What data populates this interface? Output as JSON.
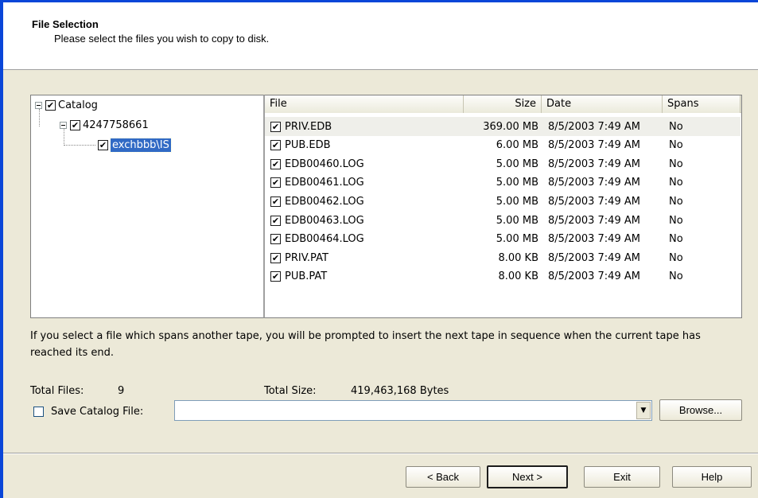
{
  "header": {
    "title": "File Selection",
    "subtitle": "Please select the files you wish to copy to disk."
  },
  "tree": {
    "nodes": [
      {
        "label": "Catalog",
        "checked": true,
        "expanded": true
      },
      {
        "label": "4247758661",
        "checked": true,
        "expanded": true
      },
      {
        "label": "exchbbb\\IS",
        "checked": true,
        "selected": true
      }
    ]
  },
  "file_list": {
    "columns": [
      "File",
      "Size",
      "Date",
      "Spans"
    ],
    "rows": [
      {
        "file": "PRIV.EDB",
        "size": "369.00 MB",
        "date": "8/5/2003 7:49 AM",
        "spans": "No",
        "checked": true
      },
      {
        "file": "PUB.EDB",
        "size": "6.00 MB",
        "date": "8/5/2003 7:49 AM",
        "spans": "No",
        "checked": true
      },
      {
        "file": "EDB00460.LOG",
        "size": "5.00 MB",
        "date": "8/5/2003 7:49 AM",
        "spans": "No",
        "checked": true
      },
      {
        "file": "EDB00461.LOG",
        "size": "5.00 MB",
        "date": "8/5/2003 7:49 AM",
        "spans": "No",
        "checked": true
      },
      {
        "file": "EDB00462.LOG",
        "size": "5.00 MB",
        "date": "8/5/2003 7:49 AM",
        "spans": "No",
        "checked": true
      },
      {
        "file": "EDB00463.LOG",
        "size": "5.00 MB",
        "date": "8/5/2003 7:49 AM",
        "spans": "No",
        "checked": true
      },
      {
        "file": "EDB00464.LOG",
        "size": "5.00 MB",
        "date": "8/5/2003 7:49 AM",
        "spans": "No",
        "checked": true
      },
      {
        "file": "PRIV.PAT",
        "size": "8.00 KB",
        "date": "8/5/2003 7:49 AM",
        "spans": "No",
        "checked": true
      },
      {
        "file": "PUB.PAT",
        "size": "8.00 KB",
        "date": "8/5/2003 7:49 AM",
        "spans": "No",
        "checked": true
      }
    ]
  },
  "info": {
    "text": "If you select a file which spans another tape, you will be prompted to insert the next tape in sequence when the current tape has reached its end."
  },
  "totals": {
    "files_label": "Total Files:",
    "files_value": "9",
    "size_label": "Total Size:",
    "size_value": "419,463,168 Bytes"
  },
  "save_catalog": {
    "label": "Save Catalog File:",
    "checked": false,
    "value": ""
  },
  "buttons": {
    "browse": "Browse...",
    "back": "< Back",
    "next": "Next >",
    "exit": "Exit",
    "help": "Help"
  },
  "colors": {
    "accent": "#0a46d8",
    "selection": "#316ac5",
    "dialog_bg": "#ece9d8"
  }
}
